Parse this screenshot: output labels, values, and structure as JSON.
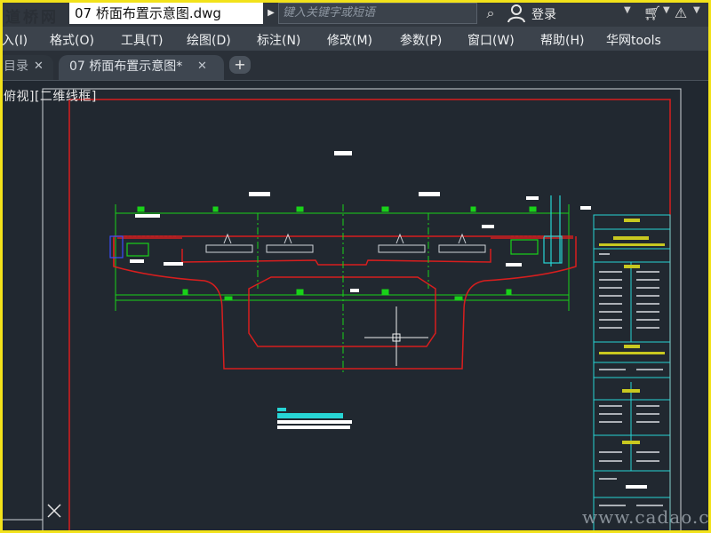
{
  "titlebar": {
    "logo_text": "道桥网",
    "document_title": "07 桥面布置示意图.dwg",
    "search_placeholder": "键入关键字或短语",
    "login_label": "登录",
    "icons": [
      "binoculars-icon",
      "user-icon",
      "cart-icon",
      "exchange-icon"
    ]
  },
  "menu": {
    "items": [
      "入(I)",
      "格式(O)",
      "工具(T)",
      "绘图(D)",
      "标注(N)",
      "修改(M)",
      "参数(P)",
      "窗口(W)",
      "帮助(H)",
      "华网tools"
    ]
  },
  "tabs": {
    "items": [
      {
        "label": "目录"
      },
      {
        "label": "07 桥面布置示意图*"
      }
    ],
    "close_glyph": "✕",
    "add_glyph": "+"
  },
  "viewport": {
    "label": "俯视][二维线框]"
  },
  "watermark": "www.cadao.com",
  "colors": {
    "accent_frame": "#f2e21a",
    "canvas": "#212830",
    "red": "#d81e1e",
    "green": "#19d219",
    "cyan": "#27d5d5",
    "white": "#ffffff"
  }
}
